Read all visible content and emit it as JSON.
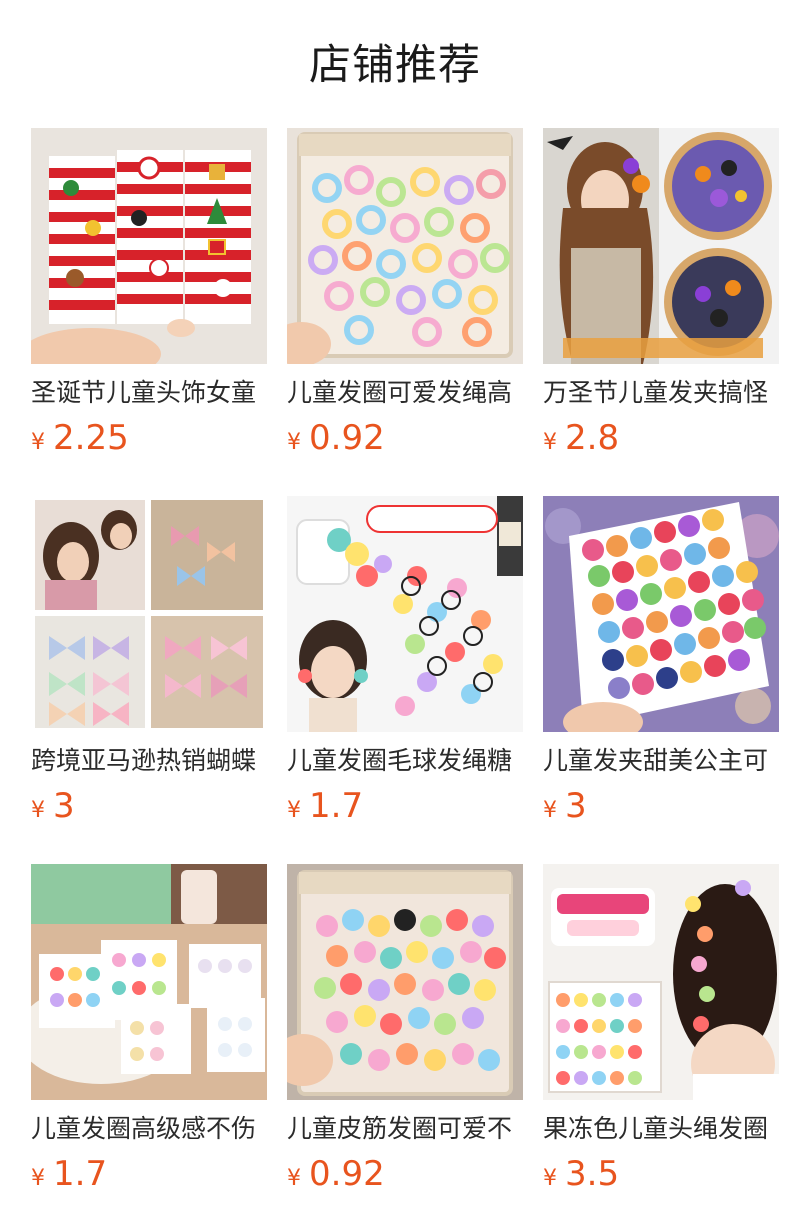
{
  "header": {
    "title": "店铺推荐"
  },
  "colors": {
    "price": "#e8541e",
    "text": "#2b2b2b"
  },
  "products": [
    {
      "name": "圣诞节儿童头饰女童",
      "currency": "¥",
      "price": "2.25",
      "image_icon": "christmas-hair-clips-image"
    },
    {
      "name": "儿童发圈可爱发绳高",
      "currency": "¥",
      "price": "0.92",
      "image_icon": "pastel-hair-ties-bag-image"
    },
    {
      "name": "万圣节儿童发夹搞怪",
      "currency": "¥",
      "price": "2.8",
      "image_icon": "halloween-hair-clips-image"
    },
    {
      "name": "跨境亚马逊热销蝴蝶",
      "currency": "¥",
      "price": "3",
      "image_icon": "butterfly-bow-clips-image"
    },
    {
      "name": "儿童发圈毛球发绳糖",
      "currency": "¥",
      "price": "1.7",
      "image_icon": "pompom-hair-ties-image"
    },
    {
      "name": "儿童发夹甜美公主可",
      "currency": "¥",
      "price": "3",
      "image_icon": "flower-hair-clips-image"
    },
    {
      "name": "儿童发圈高级感不伤",
      "currency": "¥",
      "price": "1.7",
      "image_icon": "ball-hair-ties-cards-image"
    },
    {
      "name": "儿童皮筋发圈可爱不",
      "currency": "¥",
      "price": "0.92",
      "image_icon": "cartoon-hair-ties-bag-image"
    },
    {
      "name": "果冻色儿童头绳发圈",
      "currency": "¥",
      "price": "3.5",
      "image_icon": "jelly-color-hair-ties-image"
    }
  ]
}
